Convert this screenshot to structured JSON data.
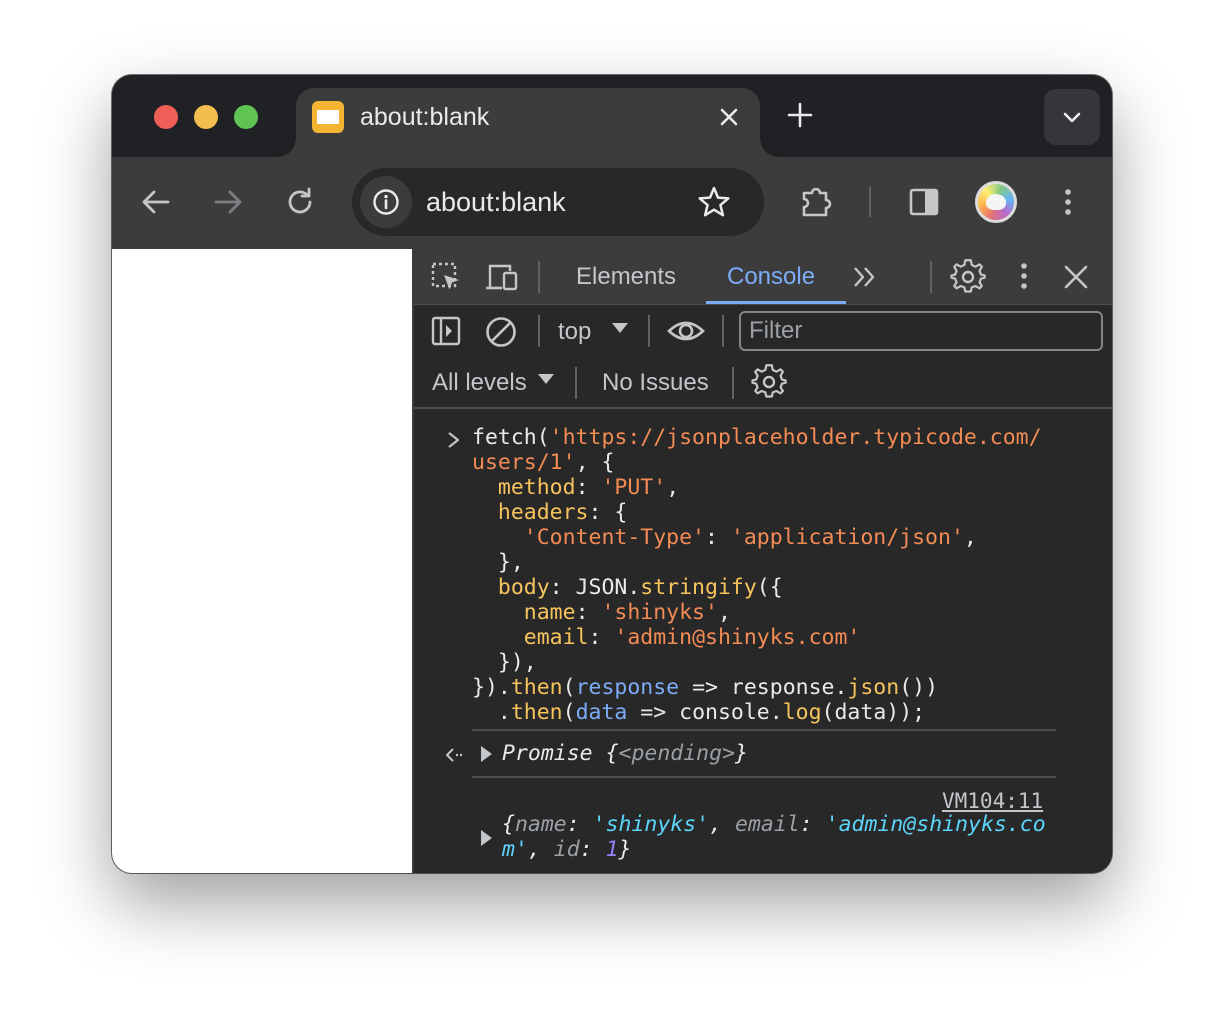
{
  "tab": {
    "title": "about:blank"
  },
  "omnibox": {
    "url": "about:blank"
  },
  "devtools": {
    "tabs": [
      "Elements",
      "Console"
    ],
    "active_tab": "Console",
    "context": "top",
    "filter_placeholder": "Filter",
    "levels": "All levels",
    "issues": "No Issues",
    "accent": "#7cacf8"
  },
  "console": {
    "input_lines": [
      [
        {
          "t": "fetch("
        },
        {
          "t": "'https://jsonplaceholder.typicode.com/",
          "c": "s"
        }
      ],
      [
        {
          "t": "users/1'",
          "c": "s"
        },
        {
          "t": ", {"
        }
      ],
      [
        {
          "t": "  "
        },
        {
          "t": "method",
          "c": "k"
        },
        {
          "t": ": "
        },
        {
          "t": "'PUT'",
          "c": "s"
        },
        {
          "t": ","
        }
      ],
      [
        {
          "t": "  "
        },
        {
          "t": "headers",
          "c": "k"
        },
        {
          "t": ": {"
        }
      ],
      [
        {
          "t": "    "
        },
        {
          "t": "'Content-Type'",
          "c": "s"
        },
        {
          "t": ": "
        },
        {
          "t": "'application/json'",
          "c": "s"
        },
        {
          "t": ","
        }
      ],
      [
        {
          "t": "  },"
        }
      ],
      [
        {
          "t": "  "
        },
        {
          "t": "body",
          "c": "k"
        },
        {
          "t": ": JSON."
        },
        {
          "t": "stringify",
          "c": "f"
        },
        {
          "t": "({"
        }
      ],
      [
        {
          "t": "    "
        },
        {
          "t": "name",
          "c": "k"
        },
        {
          "t": ": "
        },
        {
          "t": "'shinyks'",
          "c": "s"
        },
        {
          "t": ","
        }
      ],
      [
        {
          "t": "    "
        },
        {
          "t": "email",
          "c": "k"
        },
        {
          "t": ": "
        },
        {
          "t": "'admin@shinyks.com'",
          "c": "s"
        }
      ],
      [
        {
          "t": "  }),"
        }
      ],
      [
        {
          "t": "})."
        },
        {
          "t": "then",
          "c": "f"
        },
        {
          "t": "("
        },
        {
          "t": "response",
          "c": "p"
        },
        {
          "t": " => response."
        },
        {
          "t": "json",
          "c": "f"
        },
        {
          "t": "())"
        }
      ],
      [
        {
          "t": "  ."
        },
        {
          "t": "then",
          "c": "f"
        },
        {
          "t": "("
        },
        {
          "t": "data",
          "c": "p"
        },
        {
          "t": " => console."
        },
        {
          "t": "log",
          "c": "f"
        },
        {
          "t": "(data));"
        }
      ]
    ],
    "return_line": [
      {
        "t": "Promise ",
        "c": "it"
      },
      {
        "t": "{",
        "c": "it"
      },
      {
        "t": "<pending>",
        "c": "dim"
      },
      {
        "t": "}",
        "c": "it"
      }
    ],
    "log_source": "VM104:11",
    "log_lines": [
      [
        {
          "t": "{",
          "c": "it"
        },
        {
          "t": "name",
          "c": "pk"
        },
        {
          "t": ": ",
          "c": "it"
        },
        {
          "t": "'shinyks'",
          "c": "pv"
        },
        {
          "t": ", ",
          "c": "it"
        },
        {
          "t": "email",
          "c": "pk"
        },
        {
          "t": ": ",
          "c": "it"
        },
        {
          "t": "'admin@shinyks.co",
          "c": "pv"
        }
      ],
      [
        {
          "t": "m'",
          "c": "pv"
        },
        {
          "t": ", ",
          "c": "it"
        },
        {
          "t": "id",
          "c": "pk"
        },
        {
          "t": ": ",
          "c": "it"
        },
        {
          "t": "1",
          "c": "pn"
        },
        {
          "t": "}",
          "c": "it"
        }
      ]
    ]
  }
}
